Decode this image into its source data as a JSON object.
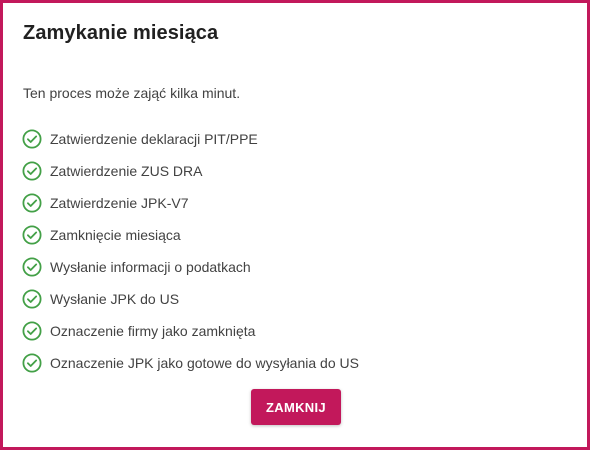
{
  "dialog": {
    "title": "Zamykanie miesiąca",
    "subtitle": "Ten proces może zająć kilka minut.",
    "steps": [
      {
        "label": "Zatwierdzenie deklaracji PIT/PPE",
        "status": "done",
        "icon": "check-circle-icon"
      },
      {
        "label": "Zatwierdzenie ZUS DRA",
        "status": "done",
        "icon": "check-circle-icon"
      },
      {
        "label": "Zatwierdzenie JPK-V7",
        "status": "done",
        "icon": "check-circle-icon"
      },
      {
        "label": "Zamknięcie miesiąca",
        "status": "done",
        "icon": "check-circle-icon"
      },
      {
        "label": "Wysłanie informacji o podatkach",
        "status": "done",
        "icon": "check-circle-icon"
      },
      {
        "label": "Wysłanie JPK do US",
        "status": "done",
        "icon": "check-circle-icon"
      },
      {
        "label": "Oznaczenie firmy jako zamknięta",
        "status": "done",
        "icon": "check-circle-icon"
      },
      {
        "label": "Oznaczenie JPK jako gotowe do wysyłania do US",
        "status": "done",
        "icon": "check-circle-icon"
      }
    ],
    "close_label": "ZAMKNIJ"
  },
  "colors": {
    "accent": "#c2185b",
    "success": "#43a047",
    "text": "#424242",
    "title": "#212121"
  }
}
